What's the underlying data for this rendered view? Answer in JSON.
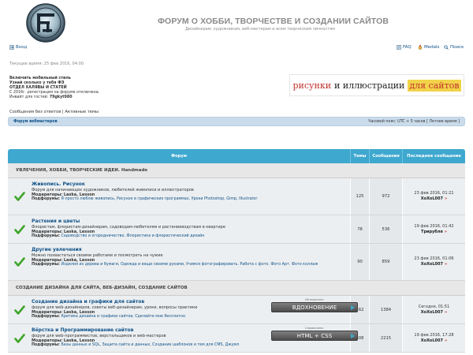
{
  "site": {
    "title": "ФОРУМ О ХОББИ, ТВОРЧЕСТВЕ И СОЗДАНИИ САЙТОВ",
    "description": "Дизайнерам, художникам, веб-мастерам и всем творческим личностям"
  },
  "nav": {
    "login": "Вход",
    "faq": "FAQ",
    "medals": "Medals",
    "search": "Поиск"
  },
  "current_time": "Текущее время: 25 фев 2016, 04:00",
  "info": {
    "line1": "Включить мобильный стиль",
    "line2": "Узнай сколько у тебя ФЭ",
    "line3": "ОТДЕЛ ХАЛЯВЫ И СТАТЕЙ",
    "line4": "С 2016г. регистрация на форуме отключена.",
    "invite_label": "Инвайт для гостей:",
    "invite_code": "79gkyt980"
  },
  "banner": {
    "part1": "рисунки",
    "part2": "и иллюстрации",
    "part3": "для сайтов"
  },
  "quicklinks": "Сообщения без ответов | Активные темы",
  "breadcrumb": "Форум вебмастеров",
  "timezone": "Часовой пояс: UTC + 5 часов [ Летнее время ]",
  "table": {
    "headers": {
      "forum": "Форум",
      "topics": "Темы",
      "posts": "Сообщения",
      "last": "Последнее сообщение"
    },
    "categories": [
      {
        "title": "УВЛЕЧЕНИЯ, ХОББИ, ТВОРЧЕСКИЕ ИДЕИ. Handmade",
        "forums": [
          {
            "title": "Живопись. Рисунок",
            "desc": "Форум для начинающих художников, любителей живописи и иллюстраторов",
            "moderators_label": "Модераторы:",
            "moderators": "Laska, Lesson",
            "subforums_label": "Подфорумы:",
            "subforums": "Я просто люблю живопись, Рисунок в графических программах, Уроки Photoshop, Gimp, Illustrator",
            "topics": "125",
            "posts": "972",
            "last_date": "23 фев 2016, 01:21",
            "last_user": "XoXoL007"
          },
          {
            "title": "Растения и цветы",
            "desc": "Флористам, флористам-дизайнерам, садоводам-любителям и растениеводствам в квартире",
            "moderators_label": "Модераторы:",
            "moderators": "Laska, Lesson",
            "subforums_label": "Подфорумы:",
            "subforums": "Садоводство и огородничество, Флористика и флористический дизайн",
            "topics": "78",
            "posts": "536",
            "last_date": "19 фев 2016, 01:42",
            "last_user": "Трирубля"
          },
          {
            "title": "Другие увлечения",
            "desc": "Можно похвастаться своими работами и посмотреть на чужие",
            "moderators_label": "Модераторы:",
            "moderators": "Laska, Lesson",
            "subforums_label": "Подфорумы:",
            "subforums": "Изделия из дерева и бумаги, Одежда и вещи своими руками, Учимся фотографировать. Работа с фото. Фото Арт. Фото коллаж",
            "topics": "90",
            "posts": "859",
            "last_date": "23 фев 2016, 01:06",
            "last_user": "XoXoL007"
          }
        ]
      },
      {
        "title": "СОЗДАНИЕ ДИЗАЙНА ДЛЯ САЙТА, ВЕБ-ДИЗАЙН, СОЗДАНИЕ САЙТОВ",
        "forums": [
          {
            "title": "Создание дизайна и графики для сайтов",
            "desc": "форум для web-дизайнеров, советы веб-дизайнерам, уроки, вопросы практики",
            "moderators_label": "Модераторы:",
            "moderators": "Laska, Lesson",
            "subforums_label": "Подфорумы:",
            "subforums": "Критика дизайна и графики сайтов, Сделайте мне бесплатно",
            "topics": "162",
            "posts": "1384",
            "last_date": "Сегодня, 01:51",
            "last_user": "XoXoL007",
            "promo_label": "Интересное:",
            "promo_button": "ВДОХНОВЕНИЕ"
          },
          {
            "title": "Вёрстка и Программирование сайтов",
            "desc": "форум для web-программистов, верстальщиков и web-мастеров",
            "moderators_label": "Модераторы:",
            "moderators": "Laska, Lesson",
            "subforums_label": "Подфорумы:",
            "subforums": "Базы данных и SQL, Защита сайта и данных, Создание шаблонов и тем для CMS, Джумл",
            "topics": "308",
            "posts": "2215",
            "last_date": "19 фев 2016, 17:28",
            "last_user": "XoXoL007",
            "promo_label": "Справочник:",
            "promo_button": "HTML + CSS"
          }
        ]
      }
    ]
  }
}
